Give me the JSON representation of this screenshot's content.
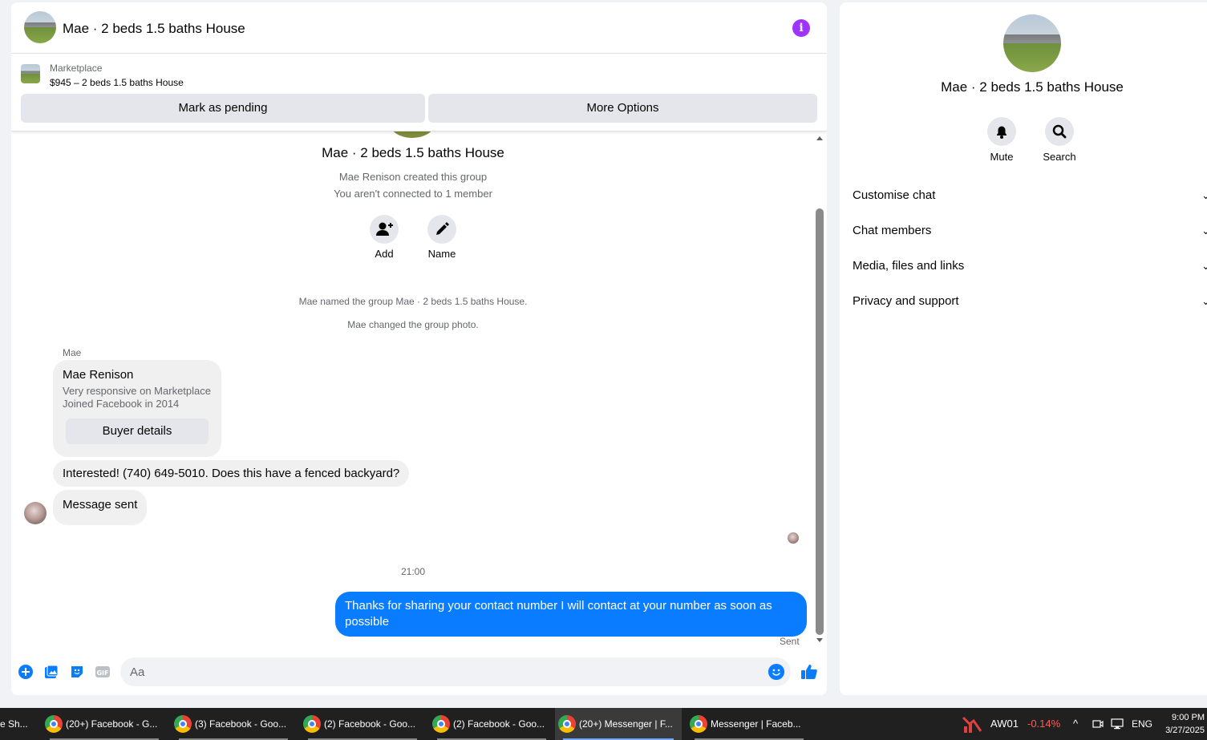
{
  "chat": {
    "title": "Mae · 2 beds 1.5 baths House",
    "marketplace_label": "Marketplace",
    "listing": "$945 – 2 beds 1.5 baths House",
    "mark_pending": "Mark as pending",
    "more_options": "More Options",
    "group_title": "Mae · 2 beds 1.5 baths House",
    "created_by": "Mae Renison created this group",
    "not_connected": "You aren't connected to 1 member",
    "add_label": "Add",
    "name_label": "Name",
    "sys_named": "Mae named the group Mae · 2 beds 1.5 baths House.",
    "sys_photo": "Mae changed the group photo.",
    "sender": "Mae",
    "card": {
      "name": "Mae Renison",
      "line1": "Very responsive on Marketplace",
      "line2": "Joined Facebook in 2014",
      "button": "Buyer details"
    },
    "msg_interested": "Interested! (740) 649-5010. Does this have a fenced backyard?",
    "msg_sent_notice": "Message sent",
    "time": "21:00",
    "outgoing": "Thanks for sharing your contact number I will contact at your number as soon as possible",
    "status": "Sent",
    "composer_placeholder": "Aa"
  },
  "info_panel": {
    "title": "Mae · 2 beds 1.5 baths House",
    "mute": "Mute",
    "search": "Search",
    "sections": [
      "Customise chat",
      "Chat members",
      "Media, files and links",
      "Privacy and support"
    ]
  },
  "taskbar": {
    "items": [
      "e Sh...",
      "(20+) Facebook - G...",
      "(3) Facebook - Goo...",
      "(2) Facebook - Goo...",
      "(2) Facebook - Goo...",
      "(20+) Messenger | F...",
      "Messenger | Faceb..."
    ],
    "stock_name": "AW01",
    "stock_change": "-0.14%",
    "lang": "ENG",
    "time": "9:00 PM",
    "date": "3/27/2025"
  },
  "colors": {
    "accent": "#0a7cff",
    "info_purple": "#a033ff",
    "stock_red": "#ff5c5c"
  }
}
